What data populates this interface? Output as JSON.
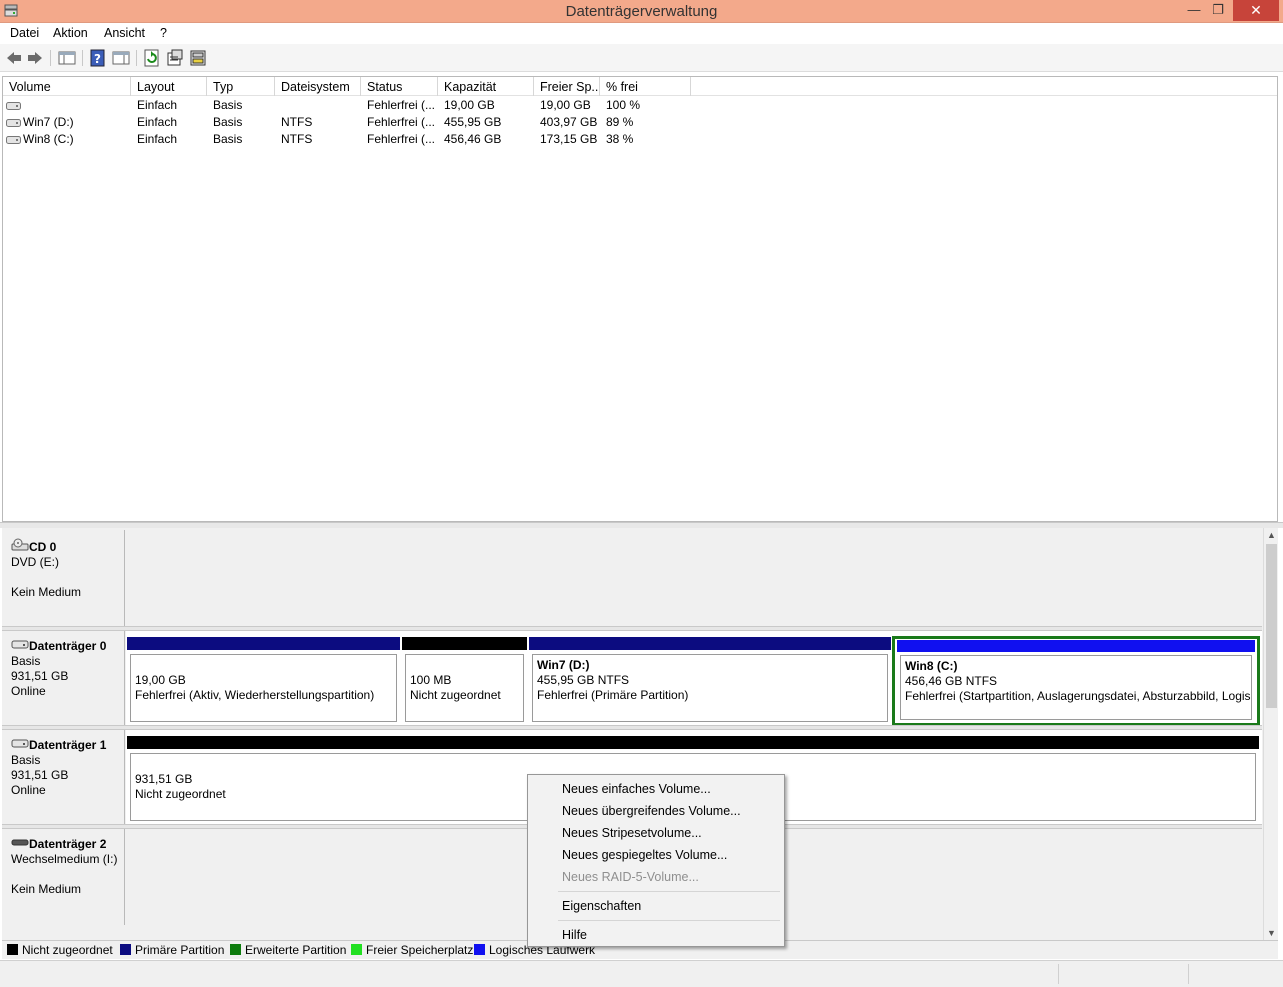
{
  "window": {
    "title": "Datenträgerverwaltung",
    "min": "—",
    "max": "❐",
    "close": "✕"
  },
  "menu": [
    "Datei",
    "Aktion",
    "Ansicht",
    "?"
  ],
  "toolbar": [
    "back-icon",
    "forward-icon",
    "console-tree-icon",
    "help-icon",
    "properties-pane-icon",
    "refresh-icon",
    "properties-icon",
    "rescan-icon"
  ],
  "columns": [
    "Volume",
    "Layout",
    "Typ",
    "Dateisystem",
    "Status",
    "Kapazität",
    "Freier Sp...",
    "% frei"
  ],
  "volumes": [
    {
      "name": "",
      "layout": "Einfach",
      "type": "Basis",
      "fs": "",
      "status": "Fehlerfrei (...",
      "capacity": "19,00 GB",
      "free": "19,00 GB",
      "pct": "100 %"
    },
    {
      "name": "Win7 (D:)",
      "layout": "Einfach",
      "type": "Basis",
      "fs": "NTFS",
      "status": "Fehlerfrei (...",
      "capacity": "455,95 GB",
      "free": "403,97 GB",
      "pct": "89 %"
    },
    {
      "name": "Win8 (C:)",
      "layout": "Einfach",
      "type": "Basis",
      "fs": "NTFS",
      "status": "Fehlerfrei (...",
      "capacity": "456,46 GB",
      "free": "173,15 GB",
      "pct": "38 %"
    }
  ],
  "disks": {
    "cd0": {
      "name": "CD 0",
      "line1": "DVD (E:)",
      "line2": "",
      "line3": "Kein Medium"
    },
    "disk0": {
      "name": "Datenträger 0",
      "line1": "Basis",
      "line2": "931,51 GB",
      "line3": "Online",
      "partitions": [
        {
          "title": "",
          "size": "19,00 GB",
          "status": "Fehlerfrei (Aktiv, Wiederherstellungspartition)"
        },
        {
          "title": "",
          "size": "100 MB",
          "status": "Nicht zugeordnet"
        },
        {
          "title": "Win7  (D:)",
          "size": "455,95 GB NTFS",
          "status": "Fehlerfrei (Primäre Partition)"
        },
        {
          "title": "Win8  (C:)",
          "size": "456,46 GB NTFS",
          "status": "Fehlerfrei (Startpartition, Auslagerungsdatei, Absturzabbild, Logis"
        }
      ]
    },
    "disk1": {
      "name": "Datenträger 1",
      "line1": "Basis",
      "line2": "931,51 GB",
      "line3": "Online",
      "partitions": [
        {
          "size": "931,51 GB",
          "status": "Nicht zugeordnet"
        }
      ]
    },
    "disk2": {
      "name": "Datenträger 2",
      "line1": "Wechselmedium (I:)",
      "line2": "",
      "line3": "Kein Medium"
    }
  },
  "legend": [
    {
      "label": "Nicht zugeordnet",
      "color": "#000000"
    },
    {
      "label": "Primäre Partition",
      "color": "#0c0c80"
    },
    {
      "label": "Erweiterte Partition",
      "color": "#0e7c0e"
    },
    {
      "label": "Freier Speicherplatz",
      "color": "#22e022"
    },
    {
      "label": "Logisches Laufwerk",
      "color": "#1010f0"
    }
  ],
  "context_menu": {
    "items": [
      "Neues einfaches Volume...",
      "Neues übergreifendes Volume...",
      "Neues Stripesetvolume...",
      "Neues gespiegeltes Volume...",
      "Neues RAID-5-Volume..."
    ],
    "properties": "Eigenschaften",
    "help": "Hilfe"
  },
  "colors": {
    "primary_bar": "#0c0c80",
    "unallocated_bar": "#000000",
    "logical_bar": "#1010f0",
    "selection": "#1a7a1a"
  }
}
